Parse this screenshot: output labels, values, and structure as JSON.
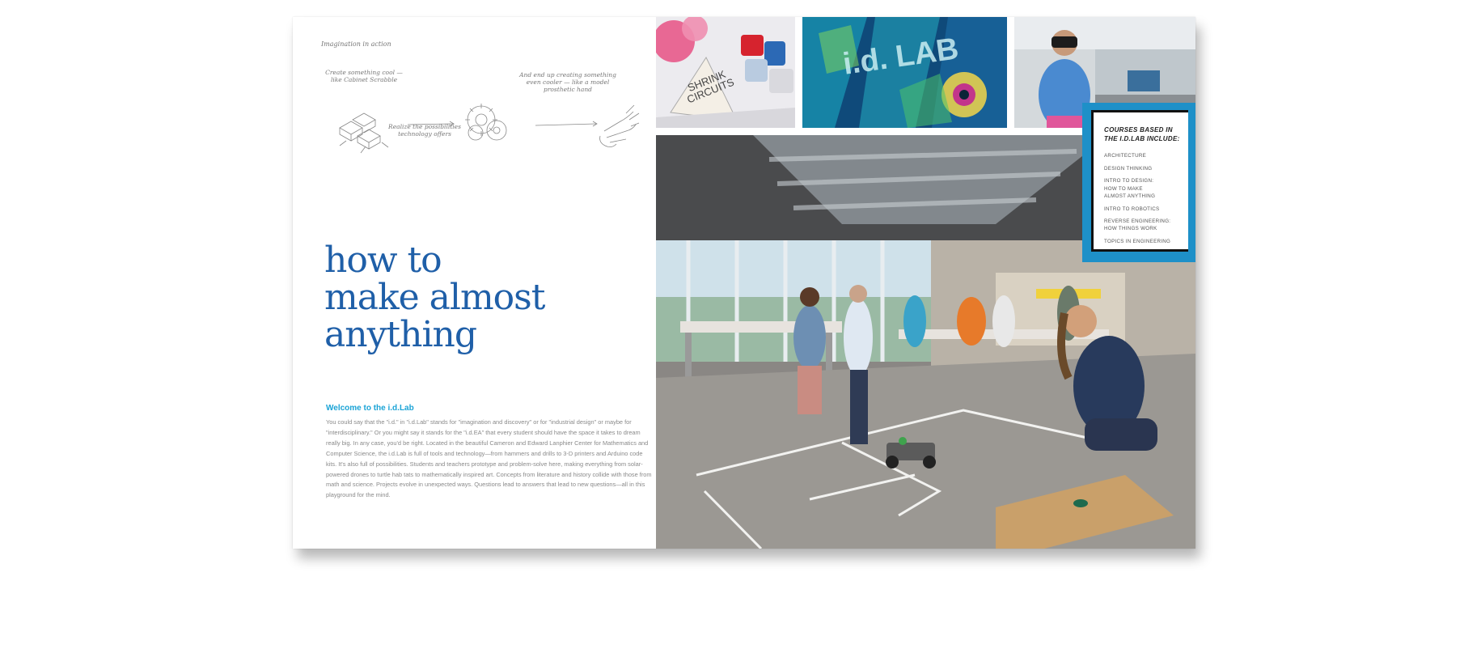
{
  "left_page": {
    "sketch": {
      "caption": "Imagination in action",
      "note_create": "Create something cool —\nlike Cabinet Scrabble",
      "note_realize": "Realize the possibilities\ntechnology offers",
      "note_end": "And end up creating something\neven cooler — like a model\nprosthetic hand"
    },
    "headline": [
      "how to",
      "make almost",
      "anything"
    ],
    "welcome": {
      "title": "Welcome to the i.d.Lab",
      "body": "You could say that the \"i.d.\" in \"i.d.Lab\" stands for \"imagination and discovery\" or for \"industrial design\" or maybe for \"interdisciplinary.\" Or you might say it stands for the \"i.d.EA\" that every student should have the space it takes to dream really big. In any case, you'd be right. Located in the beautiful Cameron and Edward Lanphier Center for Mathematics and Computer Science, the i.d.Lab is full of tools and technology—from hammers and drills to 3-D printers and Arduino code kits. It's also full of possibilities. Students and teachers prototype and problem-solve here, making everything from solar-powered drones to turtle hab tats to mathematically inspired art. Concepts from literature and history collide with those from math and science. Projects evolve in unexpected ways. Questions lead to answers that lead to new questions—all in this playground for the mind."
    }
  },
  "right_page": {
    "photo_shrink_sign": "SHRINK\nCIRCUITS",
    "photo_glass_sign": "i.d. LAB",
    "courses": {
      "title_line1": "COURSES BASED IN",
      "title_line2": "THE I.D.LAB INCLUDE:",
      "items": [
        "ARCHITECTURE",
        "DESIGN THINKING",
        "INTRO TO DESIGN:\nHOW TO MAKE\nALMOST ANYTHING",
        "INTRO TO ROBOTICS",
        "REVERSE ENGINEERING:\nHOW THINGS WORK",
        "TOPICS IN ENGINEERING"
      ]
    }
  },
  "colors": {
    "headline": "#1f5fa8",
    "welcome_title": "#1aa3d6",
    "courses_frame": "#1e90c8"
  }
}
